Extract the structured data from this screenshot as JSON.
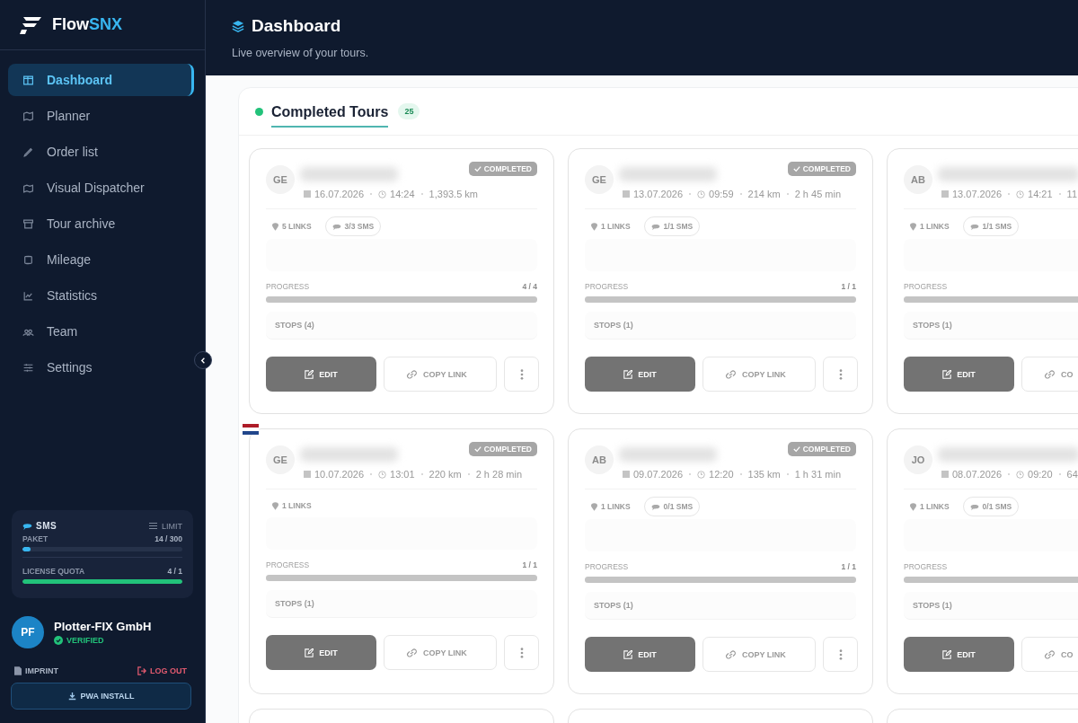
{
  "brand": {
    "name": "Flow",
    "accent": "SNX"
  },
  "nav": [
    {
      "label": "Dashboard",
      "selected": true
    },
    {
      "label": "Planner",
      "selected": false
    },
    {
      "label": "Order list",
      "selected": false
    },
    {
      "label": "Visual Dispatcher",
      "selected": false
    },
    {
      "label": "Tour archive",
      "selected": false
    },
    {
      "label": "Mileage",
      "selected": false
    },
    {
      "label": "Statistics",
      "selected": false
    },
    {
      "label": "Team",
      "selected": false
    },
    {
      "label": "Settings",
      "selected": false
    }
  ],
  "quota": {
    "title": "SMS",
    "limit": "LIMIT",
    "meters": [
      {
        "label": "PAKET",
        "reading": "14 / 300",
        "level": 0.05,
        "color": "#38b6f0"
      },
      {
        "label": "LICENSE QUOTA",
        "reading": "4 / 1",
        "level": 1,
        "color": "#22c27a"
      }
    ]
  },
  "user": {
    "initials": "PF",
    "name": "Plotter-FIX GmbH",
    "status": "VERIFIED"
  },
  "footer": {
    "imprint": "IMPRINT",
    "logout": "LOG OUT",
    "install": "PWA INSTALL"
  },
  "header": {
    "title": "Dashboard",
    "subtitle": "Live overview of your tours."
  },
  "section": {
    "title": "Completed Tours",
    "count": "25"
  },
  "tours": [
    {
      "initials": "GE",
      "status": "COMPLETED",
      "date": "16.07.2026",
      "time": "14:24",
      "distance": "1,393.5 km",
      "links": "5 LINKS",
      "sms": "3/3 SMS",
      "progress_label": "PROGRESS",
      "progress": "4 / 4",
      "level": 1,
      "stops": "STOPS (4)",
      "edit": "EDIT",
      "copy": "COPY LINK",
      "menu": true,
      "flag": false
    },
    {
      "initials": "GE",
      "status": "COMPLETED",
      "date": "13.07.2026",
      "time": "09:59",
      "distance": "214 km",
      "duration": "2 h 45 min",
      "links": "1 LINKS",
      "sms": "1/1 SMS",
      "progress_label": "PROGRESS",
      "progress": "1 / 1",
      "level": 1,
      "stops": "STOPS (1)",
      "edit": "EDIT",
      "copy": "COPY LINK",
      "menu": true,
      "flag": false
    },
    {
      "initials": "AB",
      "date": "13.07.2026",
      "time": "14:21",
      "distance": "11",
      "links": "1 LINKS",
      "sms": "1/1 SMS",
      "progress_label": "PROGRESS",
      "level": 1,
      "stops": "STOPS (1)",
      "edit": "EDIT",
      "copy": "CO",
      "menu": false,
      "flag": false
    },
    {
      "initials": "GE",
      "status": "COMPLETED",
      "date": "10.07.2026",
      "time": "13:01",
      "distance": "220 km",
      "duration": "2 h 28 min",
      "links": "1 LINKS",
      "progress_label": "PROGRESS",
      "progress": "1 / 1",
      "level": 1,
      "stops": "STOPS (1)",
      "edit": "EDIT",
      "copy": "COPY LINK",
      "menu": true,
      "flag": true
    },
    {
      "initials": "AB",
      "status": "COMPLETED",
      "date": "09.07.2026",
      "time": "12:20",
      "distance": "135 km",
      "duration": "1 h 31 min",
      "links": "1 LINKS",
      "sms": "0/1 SMS",
      "progress_label": "PROGRESS",
      "progress": "1 / 1",
      "level": 1,
      "stops": "STOPS (1)",
      "edit": "EDIT",
      "copy": "COPY LINK",
      "menu": true,
      "flag": false
    },
    {
      "initials": "JO",
      "date": "08.07.2026",
      "time": "09:20",
      "distance": "64",
      "links": "1 LINKS",
      "sms": "0/1 SMS",
      "progress_label": "PROGRESS",
      "level": 1,
      "stops": "STOPS (1)",
      "edit": "EDIT",
      "copy": "CO",
      "menu": false,
      "flag": false
    }
  ]
}
